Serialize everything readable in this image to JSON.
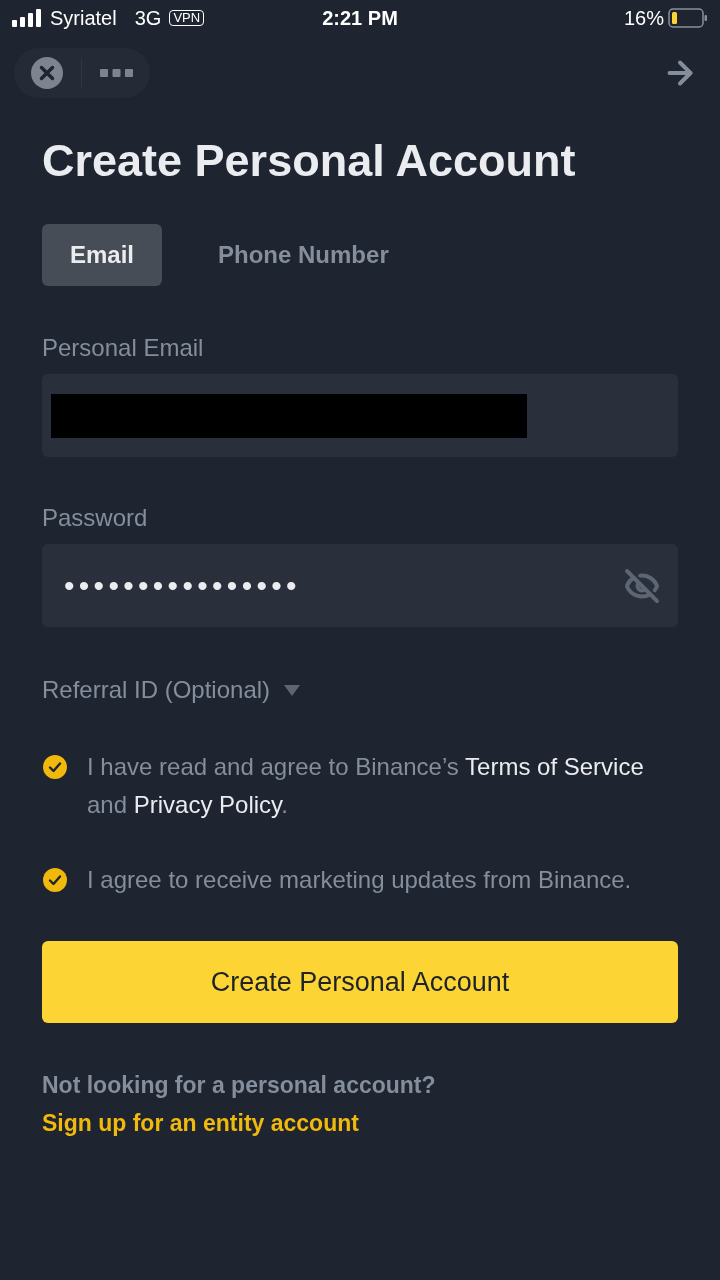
{
  "status_bar": {
    "carrier": "Syriatel",
    "network": "3G",
    "vpn": "VPN",
    "time": "2:21 PM",
    "battery": "16%"
  },
  "title": "Create Personal Account",
  "tabs": [
    {
      "label": "Email",
      "selected": true
    },
    {
      "label": "Phone Number",
      "selected": false
    }
  ],
  "fields": [
    {
      "kind": "email",
      "label": "Personal Email",
      "redacted": true
    },
    {
      "kind": "password",
      "label": "Password",
      "value": "••••••••••••••••"
    }
  ],
  "referral": {
    "label": "Referral ID (Optional)",
    "expanded": false
  },
  "agreements": [
    {
      "checked": true,
      "segments": [
        {
          "kind": "plain",
          "text": "I have read and agree to Binance’s "
        },
        {
          "kind": "link",
          "text": "Terms of Service"
        },
        {
          "kind": "plain",
          "text": " and "
        },
        {
          "kind": "link",
          "text": "Privacy Policy"
        },
        {
          "kind": "plain",
          "text": "."
        }
      ]
    },
    {
      "checked": true,
      "segments": [
        {
          "kind": "plain",
          "text": "I agree to receive marketing updates from Binance."
        }
      ]
    }
  ],
  "submit": {
    "label": "Create Personal Account"
  },
  "footer": {
    "text": "Not looking for a personal account?",
    "link": "Sign up for an entity account"
  }
}
